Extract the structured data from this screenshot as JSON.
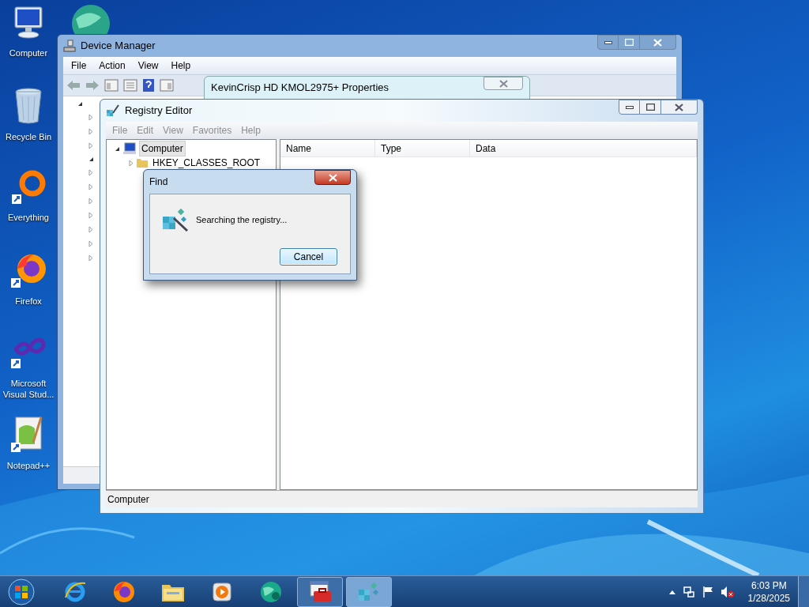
{
  "desktop_icons": [
    {
      "kind": "computer",
      "label": "Computer"
    },
    {
      "kind": "recycle",
      "label": "Recycle Bin"
    },
    {
      "kind": "everything",
      "label": "Everything"
    },
    {
      "kind": "firefox",
      "label": "Firefox"
    },
    {
      "kind": "studio",
      "label": "Microsoft Visual Stud..."
    },
    {
      "kind": "notepad",
      "label": "Notepad++"
    }
  ],
  "device_manager": {
    "title": "Device Manager",
    "menu": [
      "File",
      "Action",
      "View",
      "Help"
    ]
  },
  "properties_dialog": {
    "title": "KevinCrisp HD KMOL2975+ Properties"
  },
  "registry_editor": {
    "title": "Registry Editor",
    "menu": [
      {
        "label": "File",
        "disabled": true
      },
      {
        "label": "Edit",
        "disabled": true
      },
      {
        "label": "View",
        "disabled": true
      },
      {
        "label": "Favorites",
        "disabled": true
      },
      {
        "label": "Help",
        "disabled": true
      }
    ],
    "tree": [
      {
        "label": "Computer",
        "expanded": true,
        "selected": true,
        "children": [
          {
            "label": "HKEY_CLASSES_ROOT",
            "expanded": false,
            "selected": false
          }
        ]
      }
    ],
    "columns": [
      "Name",
      "Type",
      "Data"
    ],
    "status_bar": "Computer"
  },
  "find_dialog": {
    "title": "Find",
    "message": "Searching the registry...",
    "buttons": [
      "Cancel"
    ]
  },
  "taskbar": {
    "items": [
      {
        "kind": "ie",
        "running": false,
        "selected": false
      },
      {
        "kind": "firefox",
        "running": false,
        "selected": false
      },
      {
        "kind": "folder",
        "running": false,
        "selected": false
      },
      {
        "kind": "media",
        "running": false,
        "selected": false
      },
      {
        "kind": "globe",
        "running": false,
        "selected": false
      },
      {
        "kind": "toolbox",
        "running": true,
        "selected": false
      },
      {
        "kind": "registry",
        "running": true,
        "selected": true
      }
    ],
    "clock": {
      "time": "6:03 PM",
      "date": "1/28/2025"
    }
  }
}
